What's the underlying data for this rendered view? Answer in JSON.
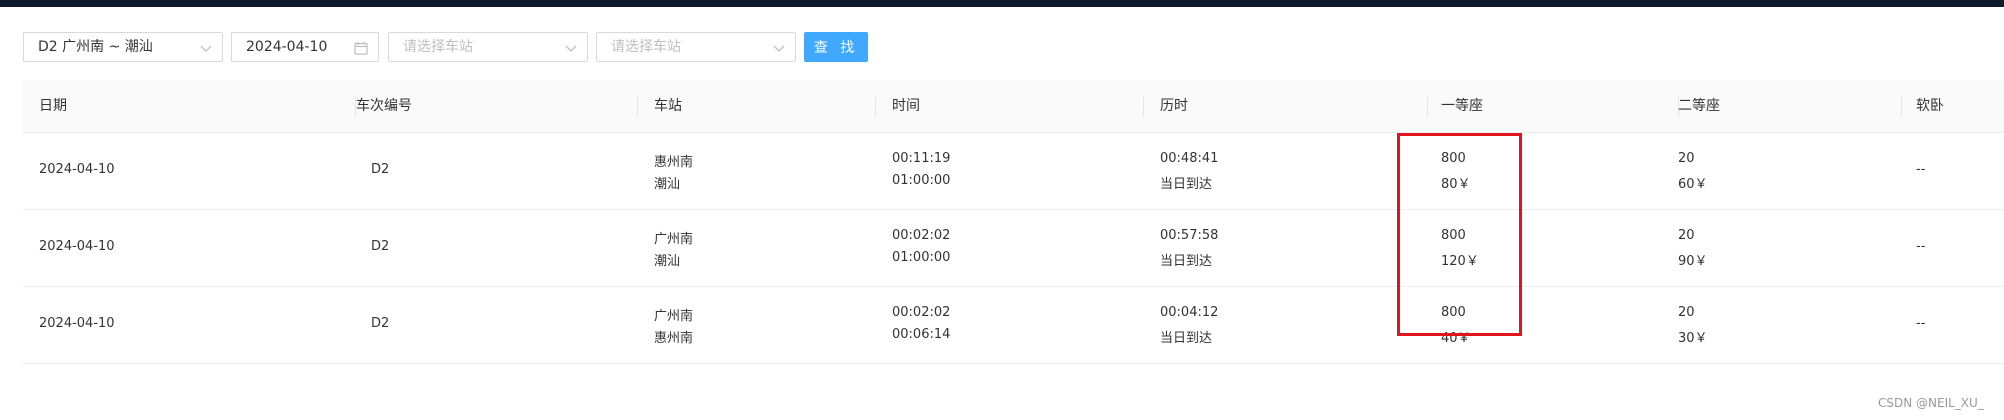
{
  "filters": {
    "train_select": "D2 广州南 ~ 潮汕",
    "date": "2024-04-10",
    "start_station_placeholder": "请选择车站",
    "end_station_placeholder": "请选择车站",
    "search_button": "查 找"
  },
  "table": {
    "headers": [
      "日期",
      "车次编号",
      "车站",
      "时间",
      "历时",
      "一等座",
      "二等座",
      "软卧"
    ],
    "rows": [
      {
        "date": "2024-04-10",
        "train": "D2",
        "station_from": "惠州南",
        "station_to": "潮汕",
        "time_depart": "00:11:19",
        "time_arrive": "01:00:00",
        "duration": "00:48:41",
        "arrival_day": "当日到达",
        "first_count": "800",
        "first_price": "80￥",
        "second_count": "20",
        "second_price": "60￥",
        "soft_sleeper": "--"
      },
      {
        "date": "2024-04-10",
        "train": "D2",
        "station_from": "广州南",
        "station_to": "潮汕",
        "time_depart": "00:02:02",
        "time_arrive": "01:00:00",
        "duration": "00:57:58",
        "arrival_day": "当日到达",
        "first_count": "800",
        "first_price": "120￥",
        "second_count": "20",
        "second_price": "90￥",
        "soft_sleeper": "--"
      },
      {
        "date": "2024-04-10",
        "train": "D2",
        "station_from": "广州南",
        "station_to": "惠州南",
        "time_depart": "00:02:02",
        "time_arrive": "00:06:14",
        "duration": "00:04:12",
        "arrival_day": "当日到达",
        "first_count": "800",
        "first_price": "40￥",
        "second_count": "20",
        "second_price": "30￥",
        "soft_sleeper": "--"
      }
    ]
  },
  "watermark": "CSDN @NEIL_XU_",
  "colors": {
    "primary": "#40a9ff",
    "highlight": "#e0141e",
    "topbar": "#0f1b2d"
  }
}
